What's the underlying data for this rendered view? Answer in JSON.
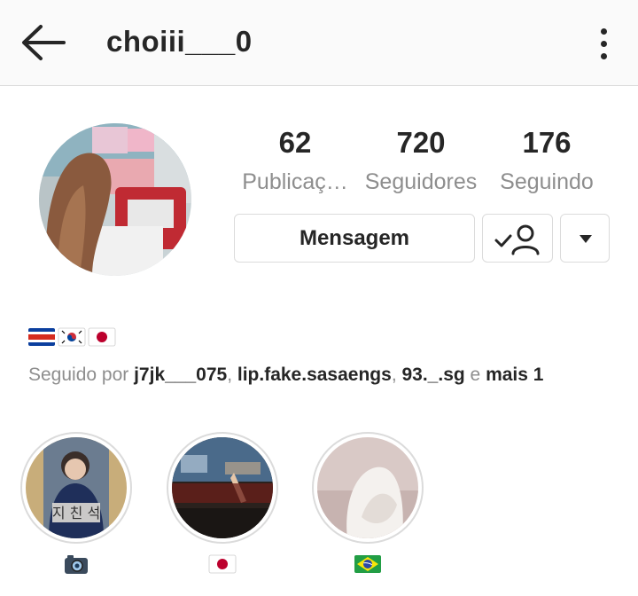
{
  "header": {
    "username": "choiii___0"
  },
  "profile": {
    "stats": [
      {
        "value": "62",
        "label": "Publicaç…"
      },
      {
        "value": "720",
        "label": "Seguidores"
      },
      {
        "value": "176",
        "label": "Seguindo"
      }
    ],
    "message_label": "Mensagem",
    "bio_flags": [
      "costa-rica-flag",
      "south-korea-flag",
      "japan-flag"
    ],
    "followed_by": {
      "prefix": "Seguido por ",
      "users": [
        "j7jk___075",
        "lip.fake.sasaengs",
        "93._.sg"
      ],
      "sep": ", ",
      "and": " e ",
      "more": "mais 1"
    }
  },
  "highlights": [
    {
      "icon": "camera-icon"
    },
    {
      "icon": "japan-flag"
    },
    {
      "icon": "brazil-flag"
    }
  ],
  "colors": {
    "text": "#262626",
    "muted": "#8e8e8e",
    "border": "#dbdbdb",
    "header_bg": "#fafafa"
  }
}
